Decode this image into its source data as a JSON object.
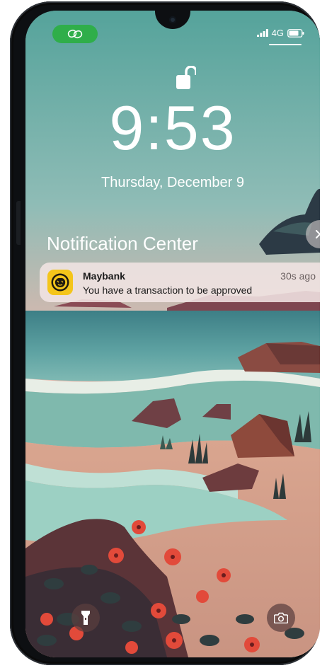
{
  "status_bar": {
    "network": "4G",
    "link_icon": "link-icon",
    "signal_icon": "signal-icon",
    "battery_icon": "battery-icon",
    "pill_color": "#2fae4a"
  },
  "lock_screen": {
    "lock_icon": "unlocked-padlock-icon",
    "time": "9:53",
    "date": "Thursday, December 9"
  },
  "notification_center": {
    "title": "Notification Center",
    "close_icon": "close-icon",
    "notifications": [
      {
        "app": "Maybank",
        "time": "30s ago",
        "message": "You have a transaction to be approved",
        "icon": "maybank-tiger-logo",
        "icon_color": "#f4c51a"
      }
    ]
  },
  "quick_actions": {
    "flashlight_icon": "flashlight-icon",
    "camera_icon": "camera-icon"
  }
}
